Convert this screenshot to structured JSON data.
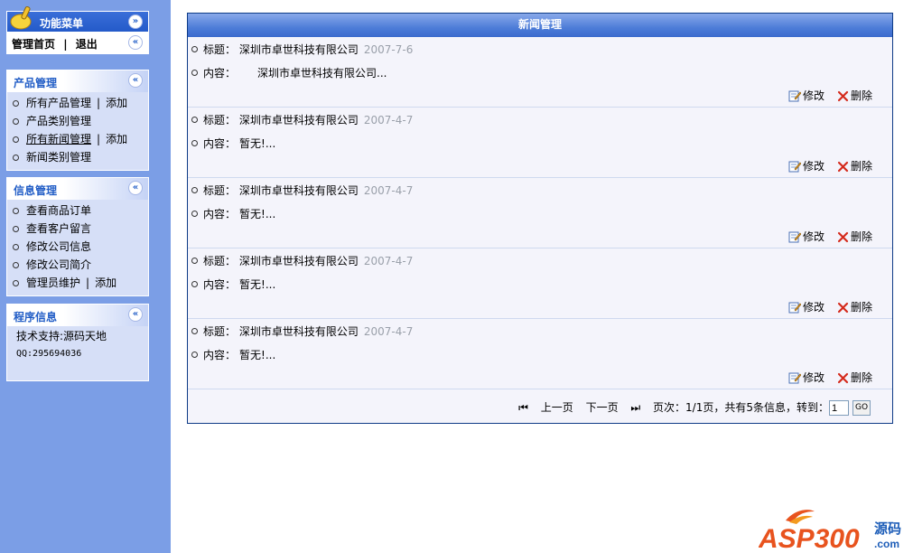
{
  "sidebar": {
    "function_menu": {
      "title": "功能菜单",
      "home": "管理首页",
      "separator": "|",
      "logout": "退出"
    },
    "product": {
      "title": "产品管理",
      "items": [
        {
          "label": "所有产品管理",
          "extra": "添加"
        },
        {
          "label": "产品类别管理"
        },
        {
          "label": "所有新闻管理",
          "extra": "添加"
        },
        {
          "label": "新闻类别管理"
        }
      ]
    },
    "info": {
      "title": "信息管理",
      "items": [
        {
          "label": "查看商品订单"
        },
        {
          "label": "查看客户留言"
        },
        {
          "label": "修改公司信息"
        },
        {
          "label": "修改公司简介"
        },
        {
          "label": "管理员维护",
          "extra": "添加"
        }
      ]
    },
    "program": {
      "title": "程序信息",
      "support": "技术支持:源码天地",
      "qq": "QQ:295694036"
    }
  },
  "main": {
    "title": "新闻管理",
    "title_label": "标题：",
    "content_label": "内容：",
    "edit_label": "修改",
    "delete_label": "删除",
    "news": [
      {
        "title": "深圳市卓世科技有限公司",
        "date": "2007-7-6",
        "content": "深圳市卓世科技有限公司..."
      },
      {
        "title": "深圳市卓世科技有限公司",
        "date": "2007-4-7",
        "content": "暂无!..."
      },
      {
        "title": "深圳市卓世科技有限公司",
        "date": "2007-4-7",
        "content": "暂无!..."
      },
      {
        "title": "深圳市卓世科技有限公司",
        "date": "2007-4-7",
        "content": "暂无!..."
      },
      {
        "title": "深圳市卓世科技有限公司",
        "date": "2007-4-7",
        "content": "暂无!..."
      }
    ],
    "pager": {
      "prev": "上一页",
      "next": "下一页",
      "info": "页次：1/1页，共有5条信息，转到：",
      "page_value": "1",
      "go": "GO"
    }
  },
  "logo": {
    "text": "ASP300",
    "suffix": "源码",
    "domain": ".com"
  },
  "colors": {
    "sidebar_bg": "#7b9ee6",
    "header_blue": "#3a6acd",
    "panel_title": "#215dc6"
  }
}
